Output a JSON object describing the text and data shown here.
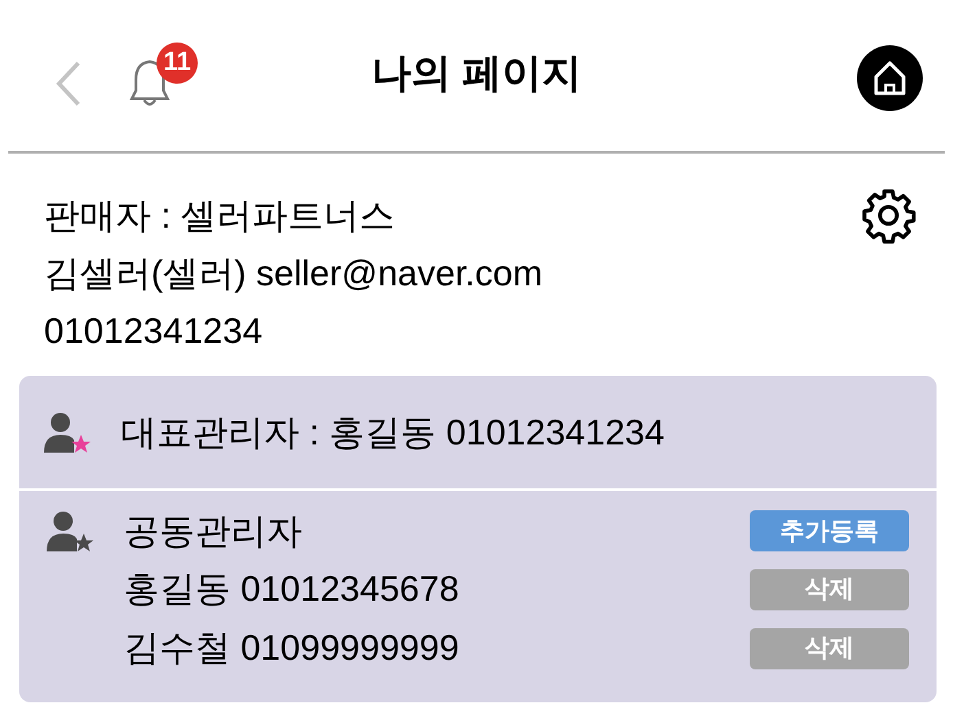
{
  "header": {
    "title": "나의 페이지",
    "notification_count": "11"
  },
  "seller": {
    "lines": [
      "판매자 : 셀러파트너스",
      "김셀러(셀러) seller@naver.com",
      "01012341234"
    ]
  },
  "admins": {
    "representative": {
      "text": "대표관리자 : 홍길동 01012341234",
      "color": "#e8409a"
    },
    "co_admins": {
      "label": "공동관리자",
      "color": "#4a4a4a",
      "add_button": "추가등록",
      "members": [
        {
          "text": "홍길동 01012345678",
          "button": "삭제"
        },
        {
          "text": "김수철 01099999999",
          "button": "삭제"
        }
      ]
    }
  }
}
